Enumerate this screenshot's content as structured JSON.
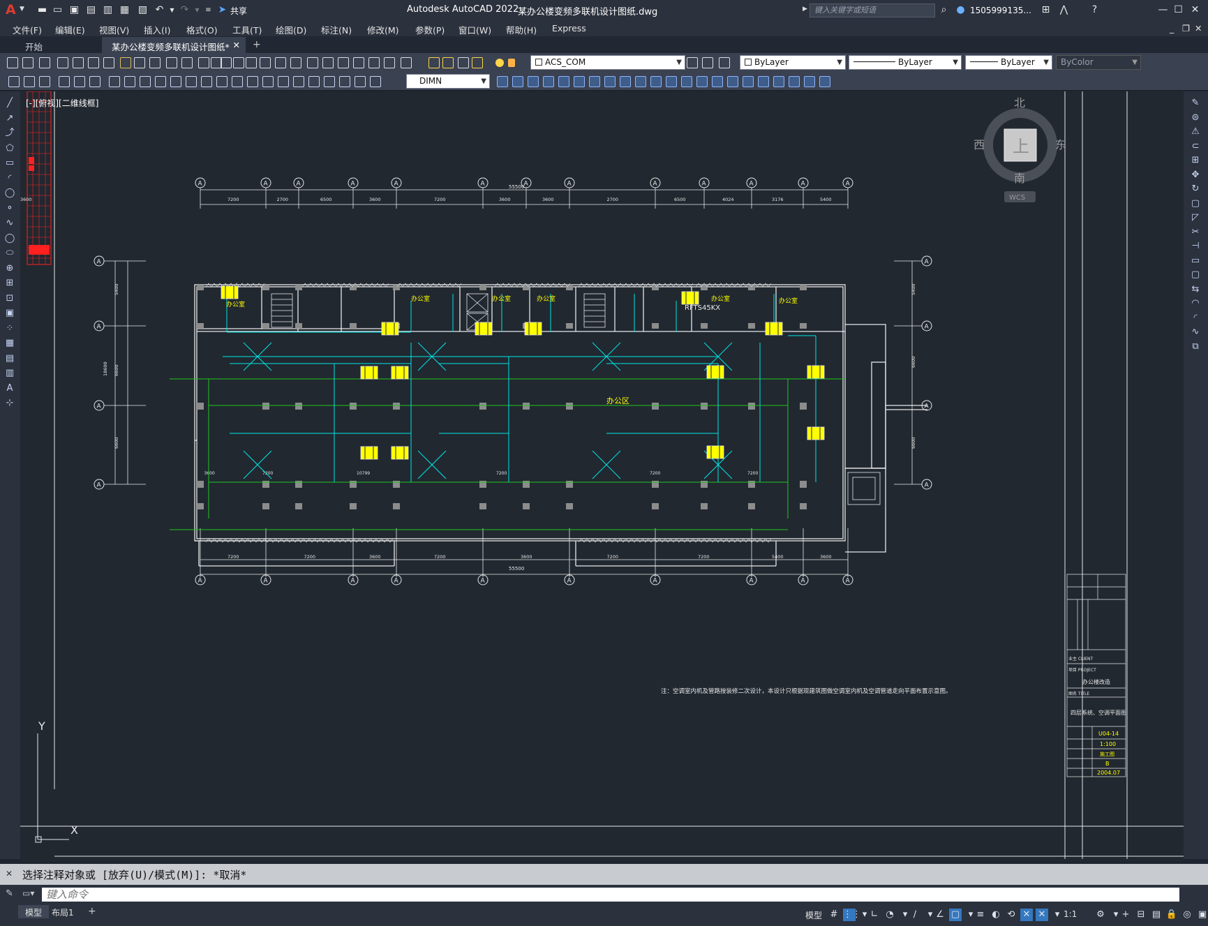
{
  "app": {
    "title": "Autodesk AutoCAD 2022",
    "document": "某办公楼变频多联机设计图纸.dwg",
    "share": "共享",
    "search_placeholder": "键入关键字或短语",
    "user": "1505999135...",
    "logo": "A"
  },
  "menu": [
    "文件(F)",
    "编辑(E)",
    "视图(V)",
    "插入(I)",
    "格式(O)",
    "工具(T)",
    "绘图(D)",
    "标注(N)",
    "修改(M)",
    "参数(P)",
    "窗口(W)",
    "帮助(H)",
    "Express"
  ],
  "tabs": [
    {
      "label": "开始",
      "active": false
    },
    {
      "label": "某办公楼变频多联机设计图纸*",
      "active": true
    }
  ],
  "toolbar": {
    "layer": "ACS_COM",
    "color": "ByLayer",
    "linetype": "ByLayer",
    "lineweight": "ByLayer",
    "plotstyle": "ByColor",
    "dimstyle": "DIMN"
  },
  "viewport_label": "[-][俯视][二维线框]",
  "viewcube": {
    "north": "北",
    "south": "南",
    "east": "东",
    "west": "西",
    "top": "上",
    "wcs": "WCS"
  },
  "drawing": {
    "overall_dim": "55500",
    "top_dims": [
      "7200",
      "2700",
      "6500",
      "3600",
      "7200",
      "3600",
      "3600",
      "2700",
      "6500",
      "4024",
      "3176",
      "5400",
      "3600"
    ],
    "bottom_dims": [
      "7200",
      "7200",
      "3600",
      "7200",
      "3600",
      "7200",
      "7200",
      "5400",
      "3600"
    ],
    "bottom_row_dims": [
      "3600",
      "7200",
      "10799",
      "7200",
      "7200",
      "7200"
    ],
    "left_dims": [
      "5400",
      "18600",
      "6600",
      "6600"
    ],
    "right_dims": [
      "5400",
      "6600",
      "6600"
    ],
    "axis_label": "A",
    "room_labels": [
      "办公室",
      "办公室",
      "办公室",
      "办公室",
      "办公室",
      "办公室",
      "办公区"
    ],
    "unit_label": "RFTS45KX",
    "note": "注：空调室内机及管路按装修二次设计，本设计只根据现建筑图做空调室内机及空调管道走向平面布置示意图。"
  },
  "title_block": {
    "project_label": "项目 PROJECT",
    "project": "办公楼改造",
    "drawing_title_label": "图名 TITLE",
    "drawing_title": "四层系统、空调平面图",
    "number": "U04-14",
    "scale": "1:100",
    "stage": "施工图",
    "version": "B",
    "date": "2004.07",
    "client_label": "业主 CLIENT"
  },
  "ucs": {
    "x": "X",
    "y": "Y"
  },
  "command": {
    "history": "选择注释对象或 [放弃(U)/模式(M)]: *取消*",
    "placeholder": "键入命令"
  },
  "status": {
    "layouts": [
      {
        "label": "模型",
        "active": true
      },
      {
        "label": "布局1",
        "active": false
      }
    ],
    "model": "模型",
    "scale": "1:1"
  }
}
